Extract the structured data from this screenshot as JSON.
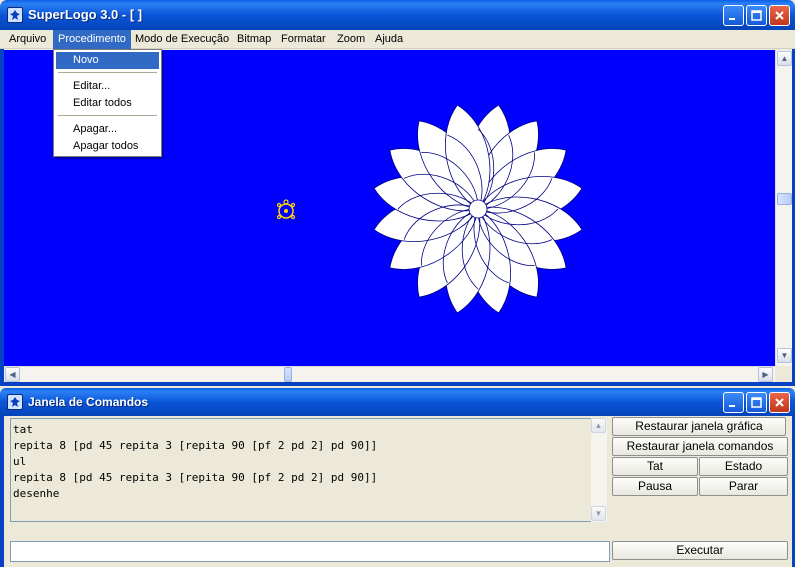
{
  "main_window": {
    "title": "SuperLogo 3.0 - [ ]",
    "menu": [
      "Arquivo",
      "Procedimento",
      "Modo de Execução",
      "Bitmap",
      "Formatar",
      "Zoom",
      "Ajuda"
    ],
    "active_menu": "Procedimento",
    "dropdown": {
      "items": [
        "Novo",
        "Editar...",
        "Editar todos",
        "Apagar...",
        "Apagar todos"
      ],
      "highlighted": "Novo"
    },
    "canvas_background": "#0000ff"
  },
  "command_window": {
    "title": "Janela de Comandos",
    "output_lines": [
      "tat",
      "repita 8 [pd 45 repita 3 [repita 90 [pf 2 pd 2] pd 90]]",
      "ul",
      "repita 8 [pd 45 repita 3 [repita 90 [pf 2 pd 2] pd 90]]",
      "desenhe"
    ],
    "input_value": "",
    "buttons": {
      "restore_graphics": "Restaurar janela gráfica",
      "restore_commands": "Restaurar janela comandos",
      "tat": "Tat",
      "estado": "Estado",
      "pausa": "Pausa",
      "parar": "Parar",
      "executar": "Executar"
    }
  },
  "colors": {
    "titlebar": "#0a56d8",
    "menu_highlight": "#316ac5",
    "drawing_fill": "#ffffff",
    "drawing_stroke": "#000080",
    "turtle": "#ffd700"
  }
}
